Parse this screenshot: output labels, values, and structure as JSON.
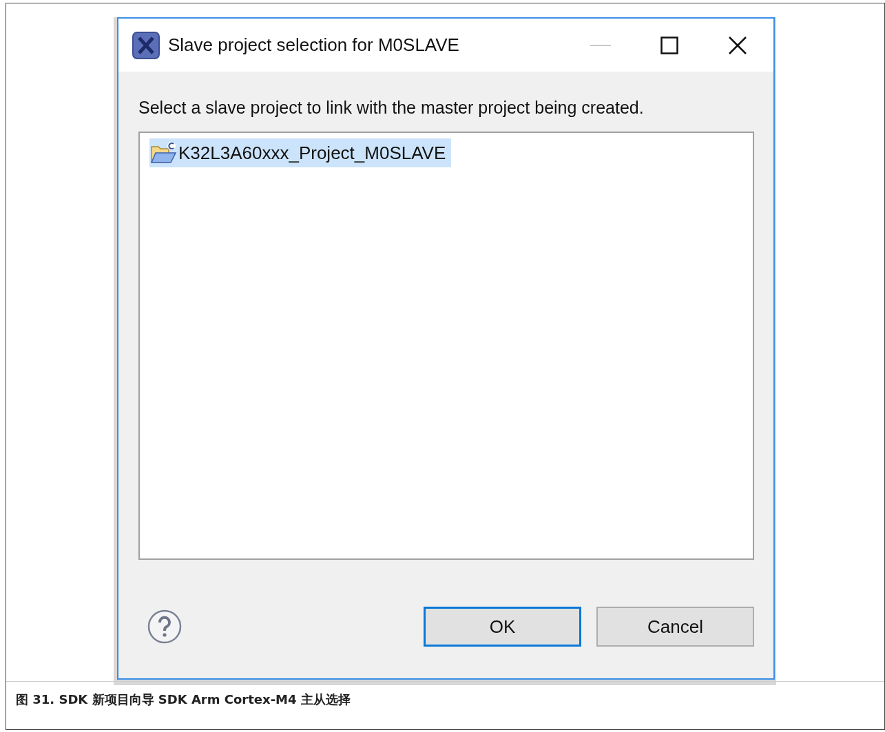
{
  "dialog": {
    "title": "Slave project selection for M0SLAVE",
    "instruction": "Select a slave project to link with the master project being created.",
    "projects": [
      {
        "label": "K32L3A60xxx_Project_M0SLAVE",
        "selected": true
      }
    ],
    "buttons": [
      {
        "label": "OK",
        "kind": "default"
      },
      {
        "label": "Cancel",
        "kind": "normal"
      }
    ]
  },
  "caption": "图 31. SDK 新项目向导 SDK Arm Cortex-M4 主从选择"
}
